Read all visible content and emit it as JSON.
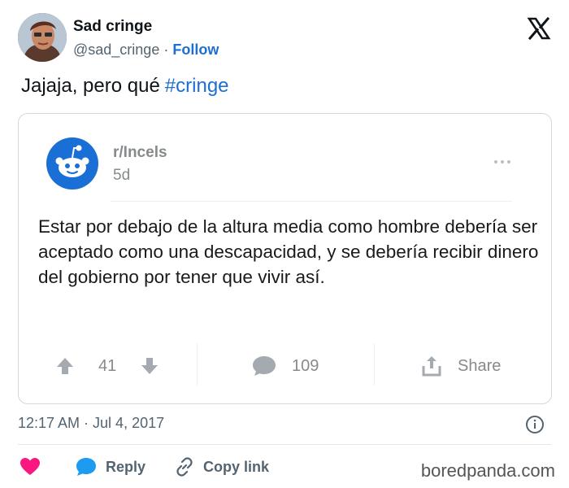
{
  "author": {
    "name": "Sad cringe",
    "handle": "@sad_cringe",
    "separator": " · ",
    "follow_label": "Follow"
  },
  "tweet": {
    "text": "Jajaja, pero qué",
    "hashtag": "#cringe"
  },
  "embed": {
    "subreddit": "r/Incels",
    "age": "5d",
    "body": "Estar por debajo de la altura media como hombre debería ser aceptado como una descapacidad, y se debería recibir dinero del gobierno por tener que vivir así.",
    "upvotes": "41",
    "comments": "109",
    "share_label": "Share"
  },
  "meta": {
    "timestamp": "12:17 AM · Jul 4, 2017"
  },
  "footer": {
    "reply_label": "Reply",
    "copy_link_label": "Copy link"
  },
  "watermark": "boredpanda.com",
  "icons": {
    "platform": "x-logo-icon",
    "reddit": "reddit-logo-icon",
    "upvote": "arrow-up-icon",
    "downvote": "arrow-down-icon",
    "comment": "comment-bubble-icon",
    "share": "share-icon",
    "info": "info-icon",
    "like": "heart-icon",
    "reply": "reply-bubble-icon",
    "link": "link-icon"
  },
  "colors": {
    "accent": "#1d6fd1",
    "heart": "#f91880",
    "reddit_blue": "#1a6fd6",
    "muted": "#878a8c"
  }
}
